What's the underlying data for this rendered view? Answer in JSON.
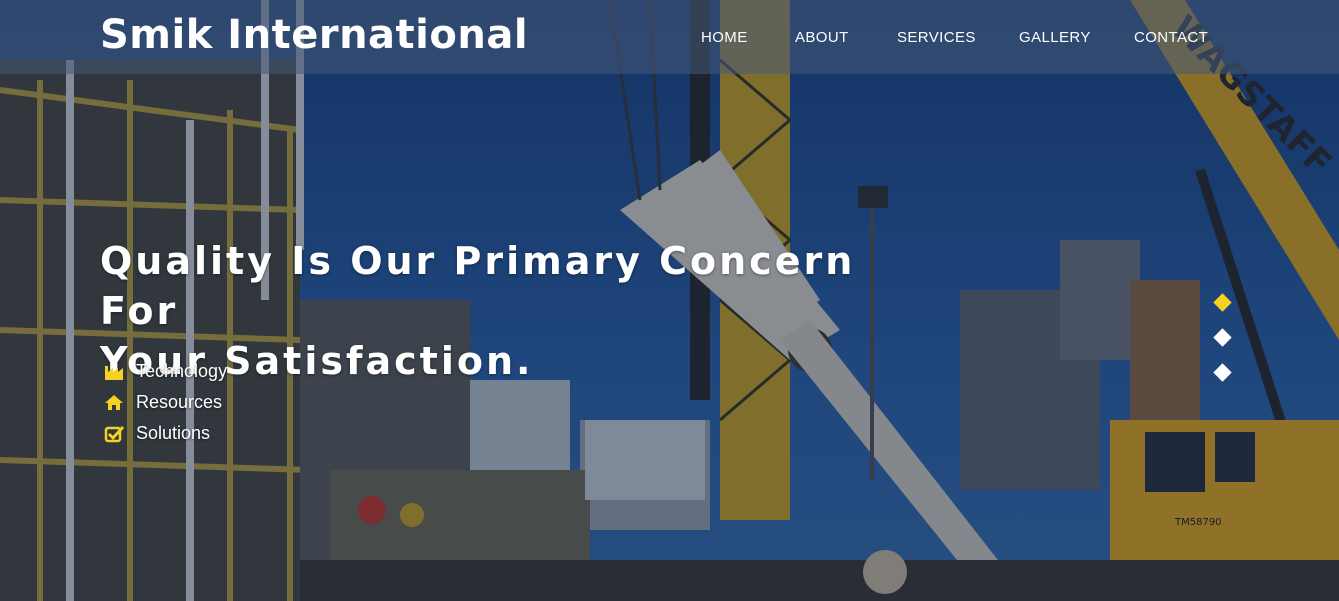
{
  "brand": {
    "name": "Smik International"
  },
  "nav": {
    "items": [
      {
        "label": "HOME"
      },
      {
        "label": "ABOUT"
      },
      {
        "label": "SERVICES"
      },
      {
        "label": "GALLERY"
      },
      {
        "label": "CONTACT"
      }
    ]
  },
  "hero": {
    "title_line1": "Quality Is Our Primary Concern For",
    "title_line2": "Your Satisfaction.",
    "features": [
      {
        "label": "Technology",
        "icon": "factory-icon"
      },
      {
        "label": "Resources",
        "icon": "home-icon"
      },
      {
        "label": "Solutions",
        "icon": "checkbox-icon"
      }
    ]
  },
  "background": {
    "crane_text": "WAGSTAFF",
    "crane_cab_text": "TM58790"
  },
  "slider": {
    "slide_count": 3,
    "active_index": 0
  },
  "colors": {
    "accent": "#f5d21f",
    "text": "#ffffff",
    "sky": "#1e4a87"
  }
}
